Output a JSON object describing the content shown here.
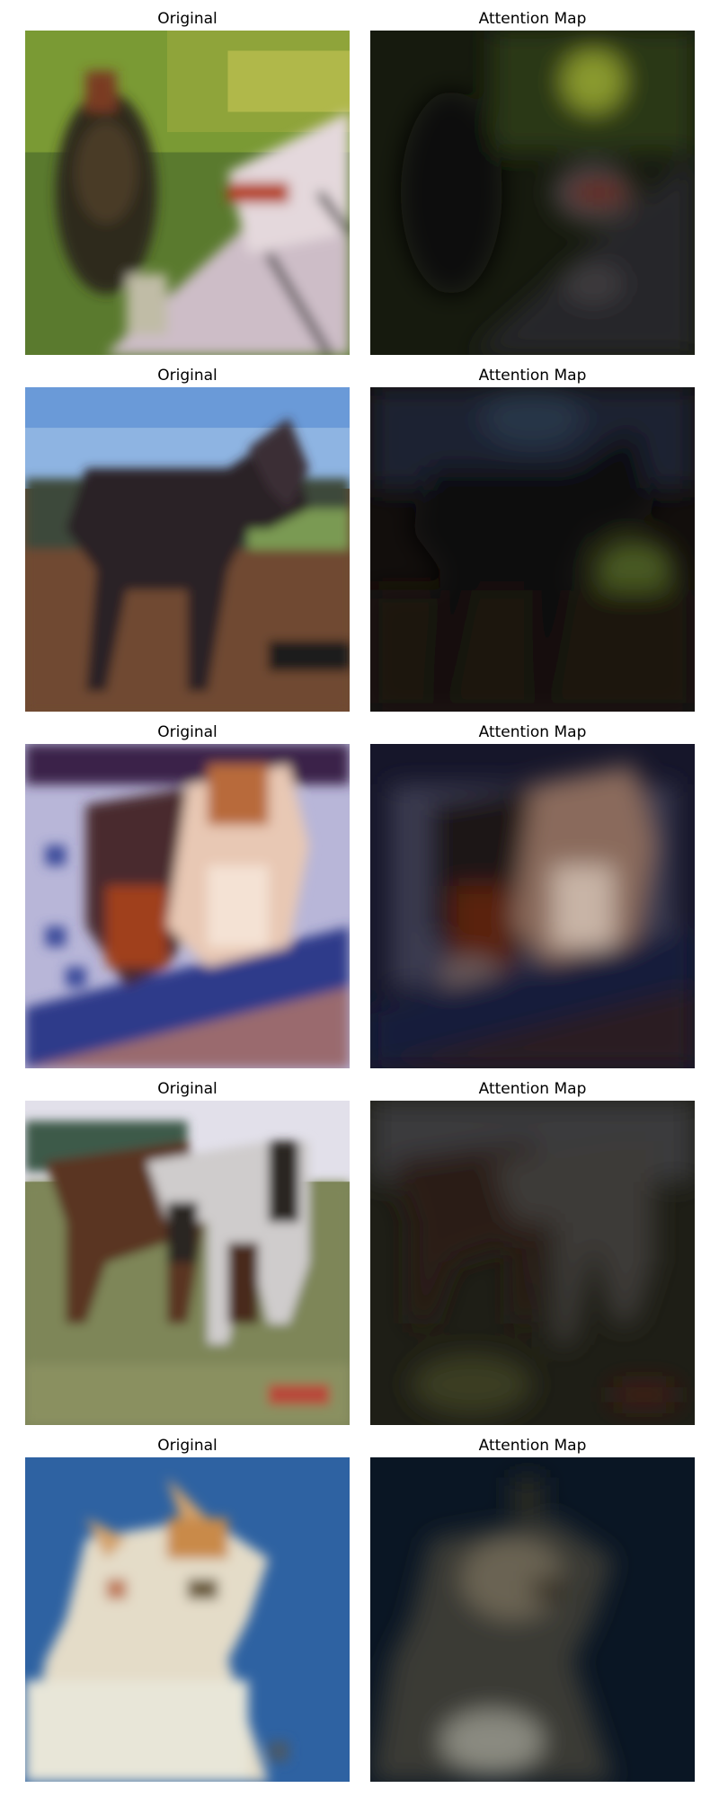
{
  "rows": [
    {
      "original": {
        "title": "Original",
        "subject": "cat-with-car"
      },
      "attention": {
        "title": "Attention Map",
        "subject": "cat-with-car-attention"
      }
    },
    {
      "original": {
        "title": "Original",
        "subject": "dark-horse-standing"
      },
      "attention": {
        "title": "Attention Map",
        "subject": "dark-horse-standing-attention"
      }
    },
    {
      "original": {
        "title": "Original",
        "subject": "cats-on-blanket"
      },
      "attention": {
        "title": "Attention Map",
        "subject": "cats-on-blanket-attention"
      }
    },
    {
      "original": {
        "title": "Original",
        "subject": "two-horses-in-field"
      },
      "attention": {
        "title": "Attention Map",
        "subject": "two-horses-in-field-attention"
      }
    },
    {
      "original": {
        "title": "Original",
        "subject": "white-cat-blue-background"
      },
      "attention": {
        "title": "Attention Map",
        "subject": "white-cat-blue-background-attention"
      }
    }
  ]
}
